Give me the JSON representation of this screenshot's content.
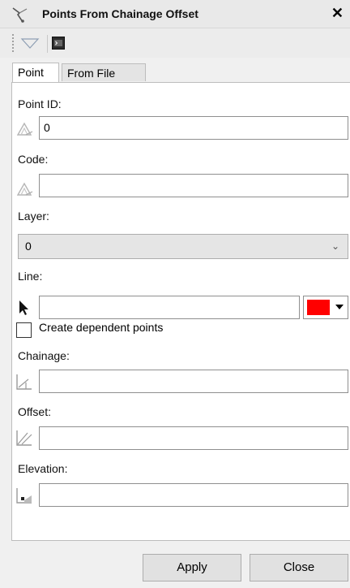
{
  "window": {
    "title": "Points From Chainage Offset",
    "close_glyph": "✕"
  },
  "toolbar": {
    "icons": [
      "grip-icon",
      "triangle-dropdown-icon",
      "terminal-icon"
    ]
  },
  "tabs": [
    {
      "label": "Point",
      "active": true
    },
    {
      "label": "From File",
      "active": false
    }
  ],
  "form": {
    "point_id": {
      "label": "Point ID:",
      "value": "0",
      "icon": "point-id-icon"
    },
    "code": {
      "label": "Code:",
      "value": "",
      "icon": "code-icon"
    },
    "layer": {
      "label": "Layer:",
      "selected": "0"
    },
    "line": {
      "label": "Line:",
      "value": "",
      "icon": "pointer-arrow-icon",
      "color": "#ff0000"
    },
    "dependent": {
      "label": "Create dependent points",
      "checked": false
    },
    "chainage": {
      "label": "Chainage:",
      "value": "",
      "icon": "chainage-icon"
    },
    "offset": {
      "label": "Offset:",
      "value": "",
      "icon": "offset-icon"
    },
    "elevation": {
      "label": "Elevation:",
      "value": "",
      "icon": "elevation-icon"
    }
  },
  "footer": {
    "apply_label": "Apply",
    "close_label": "Close"
  }
}
